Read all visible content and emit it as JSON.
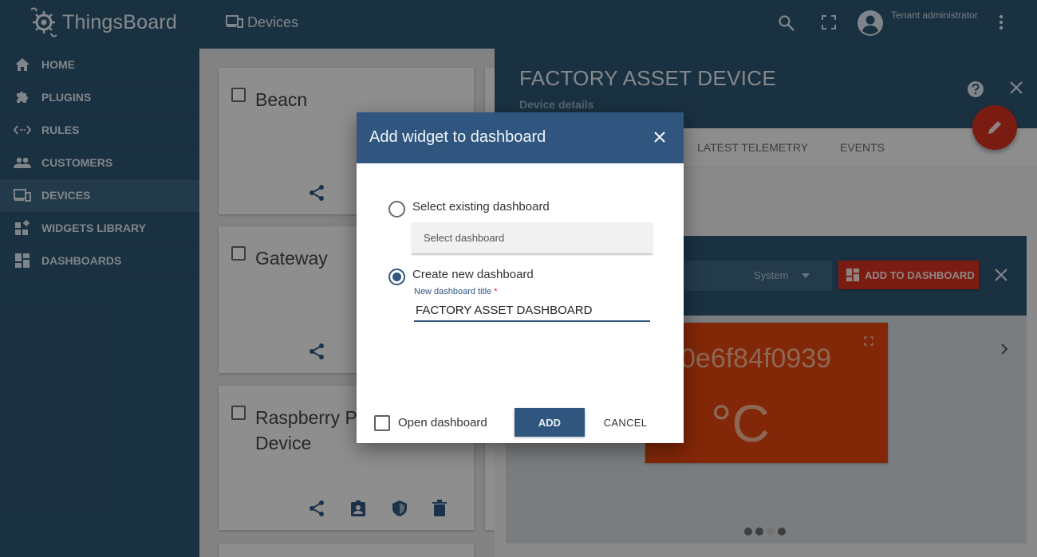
{
  "app": {
    "logo_text": "ThingsBoard"
  },
  "sidebar": {
    "items": [
      {
        "label": "HOME",
        "icon": "home-icon"
      },
      {
        "label": "PLUGINS",
        "icon": "puzzle-icon"
      },
      {
        "label": "RULES",
        "icon": "code-arrows-icon"
      },
      {
        "label": "CUSTOMERS",
        "icon": "people-icon"
      },
      {
        "label": "DEVICES",
        "icon": "devices-icon",
        "active": true
      },
      {
        "label": "WIDGETS LIBRARY",
        "icon": "widgets-icon"
      },
      {
        "label": "DASHBOARDS",
        "icon": "dashboard-icon"
      }
    ]
  },
  "topbar": {
    "title": "Devices",
    "user": "Tenant administrator"
  },
  "devices": {
    "cards": [
      {
        "title": "Beacn"
      },
      {
        "title": "Gateway"
      },
      {
        "title": "Raspberry Pi Device",
        "title_line1": "Raspberry P",
        "title_line2": "Device"
      }
    ]
  },
  "details": {
    "title": "FACTORY ASSET DEVICE",
    "subtitle": "Device details",
    "tabs": [
      "LATEST TELEMETRY",
      "EVENTS"
    ],
    "widgets_bundle_selector": "System",
    "add_to_dashboard_label": "ADD TO DASHBOARD",
    "tile_value": "0e6f84f0939",
    "tile_unit": "°C",
    "carousel_dots": 4,
    "carousel_active_dot": 2
  },
  "dialog": {
    "title": "Add widget to dashboard",
    "option_existing": "Select existing dashboard",
    "select_placeholder": "Select dashboard",
    "option_new": "Create new dashboard",
    "selected_option": "new",
    "new_title_label": "New dashboard title",
    "new_title_required": "*",
    "new_title_value": "FACTORY ASSET DASHBOARD",
    "open_dashboard_label": "Open dashboard",
    "open_dashboard_checked": false,
    "add_button": "ADD",
    "cancel_button": "CANCEL"
  },
  "colors": {
    "primary": "#305680",
    "accent": "#d4311f",
    "tile": "#e0440f"
  }
}
